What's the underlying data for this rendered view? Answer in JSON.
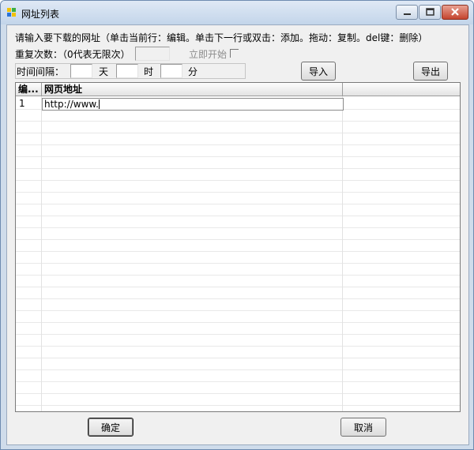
{
  "window": {
    "title": "网址列表"
  },
  "instructions": "请输入要下载的网址（单击当前行：编辑。单击下一行或双击：添加。拖动：复制。del键：删除）",
  "repeat": {
    "label": "重复次数：（0代表无限次）",
    "value": "",
    "start_now_label": "立即开始",
    "start_now_checked": false
  },
  "interval": {
    "label": "时间间隔：",
    "days_unit": "天",
    "hours_unit": "时",
    "minutes_unit": "分",
    "days": "",
    "hours": "",
    "minutes": ""
  },
  "buttons": {
    "import": "导入",
    "export": "导出",
    "ok": "确定",
    "cancel": "取消"
  },
  "table": {
    "columns": [
      "编...",
      "网页地址"
    ],
    "rows": [
      {
        "num": "1",
        "url": "http://www."
      }
    ]
  },
  "colors": {
    "title_bar": "#c3d5ea",
    "close_button": "#c4442e",
    "dialog_bg": "#f0f0f0"
  }
}
